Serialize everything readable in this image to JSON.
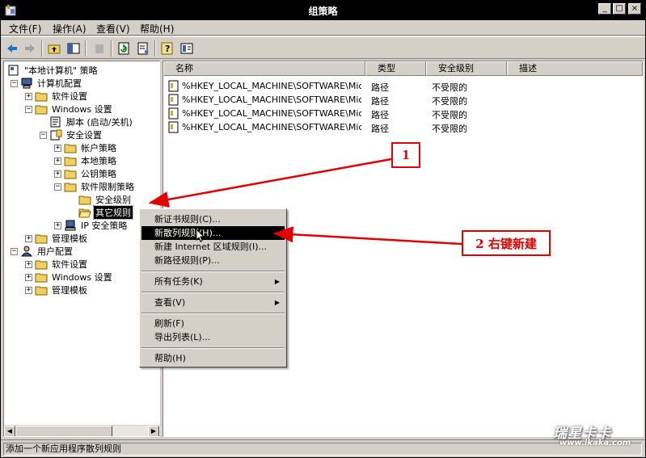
{
  "window": {
    "title": "组策略",
    "controls": [
      "minimize-icon",
      "maximize-icon",
      "close-icon"
    ]
  },
  "menubar": {
    "file": "文件(F)",
    "action": "操作(A)",
    "view": "查看(V)",
    "help": "帮助(H)"
  },
  "toolbar": {
    "icons": [
      "back-icon",
      "forward-icon",
      "up-folder-icon",
      "show-hide-tree-icon",
      "delete-icon",
      "refresh-icon",
      "export-list-icon",
      "help-icon",
      "console-tree-icon"
    ]
  },
  "tree": {
    "root": "\"本地计算机\" 策略",
    "computer_config": "计算机配置",
    "software_settings": "软件设置",
    "windows_settings": "Windows 设置",
    "scripts": "脚本 (启动/关机)",
    "security_settings": "安全设置",
    "account_policies": "帐户策略",
    "local_policies": "本地策略",
    "public_key_policies": "公钥策略",
    "software_restriction": "软件限制策略",
    "security_levels": "安全级别",
    "additional_rules": "其它规则",
    "ip_security": "IP 安全策略",
    "admin_templates": "管理模板",
    "user_config": "用户配置",
    "user_software_settings": "软件设置",
    "user_windows_settings": "Windows 设置",
    "user_admin_templates": "管理模板"
  },
  "list": {
    "columns": {
      "name": "名称",
      "type": "类型",
      "security_level": "安全级别",
      "description": "描述"
    },
    "rows": [
      {
        "name": "%HKEY_LOCAL_MACHINE\\SOFTWARE\\Micr...",
        "type": "路径",
        "level": "不受限的"
      },
      {
        "name": "%HKEY_LOCAL_MACHINE\\SOFTWARE\\Micr...",
        "type": "路径",
        "level": "不受限的"
      },
      {
        "name": "%HKEY_LOCAL_MACHINE\\SOFTWARE\\Micr...",
        "type": "路径",
        "level": "不受限的"
      },
      {
        "name": "%HKEY_LOCAL_MACHINE\\SOFTWARE\\Micr...",
        "type": "路径",
        "level": "不受限的"
      }
    ]
  },
  "context_menu": {
    "new_cert_rule": "新证书规则(C)...",
    "new_hash_rule": "新散列规则(H)...",
    "new_zone_rule": "新建 Internet 区域规则(I)...",
    "new_path_rule": "新路径规则(P)...",
    "all_tasks": "所有任务(K)",
    "view": "查看(V)",
    "refresh": "刷新(F)",
    "export_list": "导出列表(L)...",
    "help": "帮助(H)"
  },
  "statusbar": {
    "text": "添加一个新应用程序散列规则"
  },
  "annotations": {
    "callout1": "1",
    "callout2": "2 右键新建",
    "color": "#e00000"
  },
  "watermark": {
    "logo": "瑞星卡卡",
    "url": "www.ikaka.com"
  }
}
